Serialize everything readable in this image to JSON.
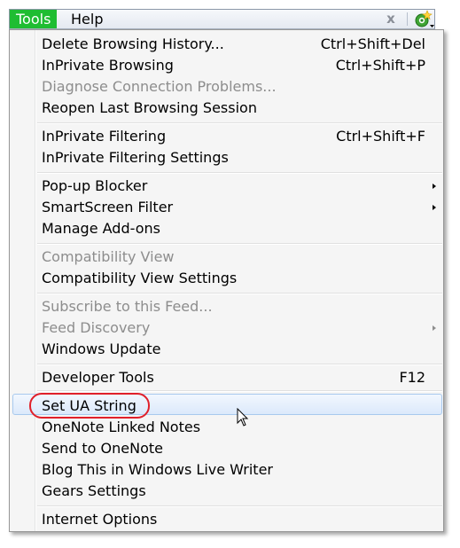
{
  "menubar": {
    "tools": "Tools",
    "help": "Help",
    "close": "x"
  },
  "menu": {
    "group1": [
      {
        "label": "Delete Browsing History...",
        "shortcut": "Ctrl+Shift+Del"
      },
      {
        "label": "InPrivate Browsing",
        "shortcut": "Ctrl+Shift+P"
      },
      {
        "label": "Diagnose Connection Problems...",
        "shortcut": "",
        "disabled": true
      },
      {
        "label": "Reopen Last Browsing Session",
        "shortcut": ""
      }
    ],
    "group2": [
      {
        "label": "InPrivate Filtering",
        "shortcut": "Ctrl+Shift+F"
      },
      {
        "label": "InPrivate Filtering Settings",
        "shortcut": ""
      }
    ],
    "group3": [
      {
        "label": "Pop-up Blocker",
        "submenu": true
      },
      {
        "label": "SmartScreen Filter",
        "submenu": true
      },
      {
        "label": "Manage Add-ons"
      }
    ],
    "group4": [
      {
        "label": "Compatibility View",
        "disabled": true
      },
      {
        "label": "Compatibility View Settings"
      }
    ],
    "group5": [
      {
        "label": "Subscribe to this Feed...",
        "disabled": true
      },
      {
        "label": "Feed Discovery",
        "disabled": true,
        "submenu": true
      },
      {
        "label": "Windows Update"
      }
    ],
    "group6": [
      {
        "label": "Developer Tools",
        "shortcut": "F12"
      }
    ],
    "group7": [
      {
        "label": "Set UA String",
        "highlighted": true
      },
      {
        "label": "OneNote Linked Notes"
      },
      {
        "label": "Send to OneNote"
      },
      {
        "label": "Blog This in Windows Live Writer"
      },
      {
        "label": "Gears Settings"
      }
    ],
    "group8": [
      {
        "label": "Internet Options"
      }
    ]
  },
  "colors": {
    "tools_accent": "#1fbd32",
    "highlight_ring": "#e0202a",
    "disabled_text": "#8d8d8d"
  }
}
